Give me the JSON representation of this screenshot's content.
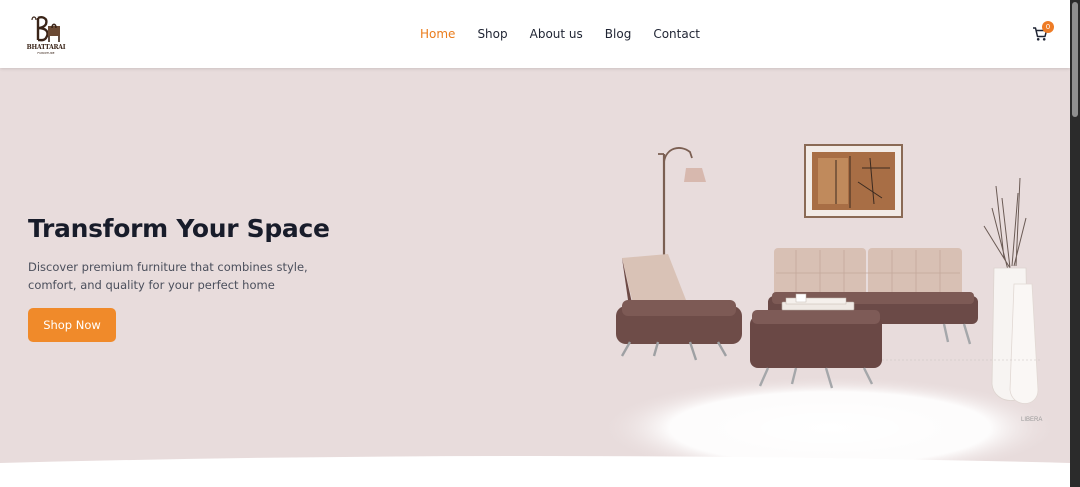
{
  "brand": {
    "name": "BHATTARAI",
    "tagline": "FURNITURE"
  },
  "nav": {
    "items": [
      {
        "label": "Home",
        "active": true
      },
      {
        "label": "Shop",
        "active": false
      },
      {
        "label": "About us",
        "active": false
      },
      {
        "label": "Blog",
        "active": false
      },
      {
        "label": "Contact",
        "active": false
      }
    ]
  },
  "cart": {
    "count": "0"
  },
  "hero": {
    "title": "Transform Your Space",
    "description": "Discover premium furniture that combines style, comfort, and quality for your perfect home",
    "cta_label": "Shop Now",
    "image_watermark": "LIBERA"
  },
  "colors": {
    "accent": "#f08a2a",
    "nav_active": "#ea7c1c",
    "hero_bg": "#e8dcdc",
    "title": "#181c2a"
  },
  "icons": {
    "cart": "cart-icon",
    "logo": "chair-logo-icon"
  }
}
